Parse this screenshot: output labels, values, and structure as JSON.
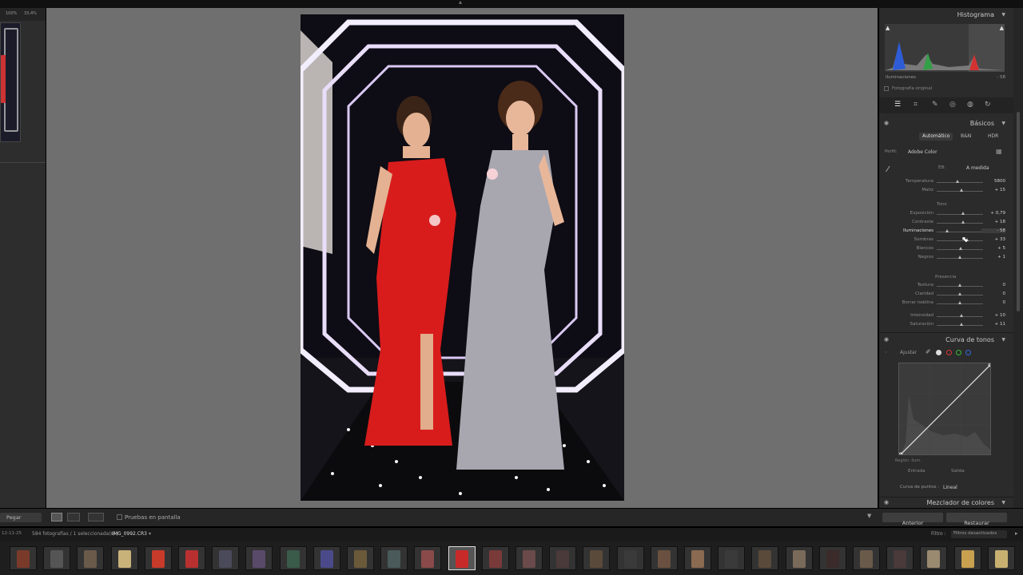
{
  "top": {
    "arrow": "▴"
  },
  "left_panel": {
    "header_a": "100%",
    "header_b": "33,4%"
  },
  "histogram": {
    "title": "Histograma",
    "readout_label": "Iluminaciones",
    "readout_value": "- 58",
    "original_photo": "Fotografía original"
  },
  "basic": {
    "title": "Básicos",
    "treatment": [
      "Automático",
      "B&N",
      "HDR"
    ],
    "profile_label": "Perfil:",
    "profile_value": "Adobe Color",
    "wb_label": "EB:",
    "wb_value": "A medida",
    "sliders_wb": [
      {
        "label": "Temperatura",
        "value": "5800",
        "pos": 0.45
      },
      {
        "label": "Matiz",
        "value": "+ 15",
        "pos": 0.55
      }
    ],
    "tone_heading": "Tono",
    "sliders_tone": [
      {
        "label": "Exposición",
        "value": "+ 0,79",
        "pos": 0.57
      },
      {
        "label": "Contraste",
        "value": "+ 18",
        "pos": 0.57
      },
      {
        "label": "Iluminaciones",
        "value": "- 58",
        "pos": 0.23
      },
      {
        "label": "Sombras",
        "value": "+ 33",
        "pos": 0.67
      },
      {
        "label": "Blancos",
        "value": "+ 5",
        "pos": 0.53
      },
      {
        "label": "Negros",
        "value": "+ 1",
        "pos": 0.51
      }
    ],
    "presence_heading": "Presencia",
    "sliders_presence": [
      {
        "label": "Textura",
        "value": "0",
        "pos": 0.5
      },
      {
        "label": "Claridad",
        "value": "0",
        "pos": 0.5
      },
      {
        "label": "Borrar neblina",
        "value": "0",
        "pos": 0.5
      },
      {
        "label": "Intensidad",
        "value": "+ 10",
        "pos": 0.55
      },
      {
        "label": "Saturación",
        "value": "+ 11",
        "pos": 0.55
      }
    ]
  },
  "curve": {
    "title": "Curva de tonos",
    "adjust_label": "Ajustar",
    "in_label": "Entrada",
    "out_label": "Salida",
    "region": "Región: Ilum.",
    "point_curve_label": "Curva de puntos :",
    "point_curve_value": "Lineal"
  },
  "mixer": {
    "title": "Mezclador de colores"
  },
  "buttons": {
    "prev": "Anterior",
    "reset": "Restaurar",
    "paste": "Pegar"
  },
  "toolbar": {
    "proof_label": "Pruebas en pantalla"
  },
  "filmstrip_bar": {
    "date": "12-11-25",
    "count": "584 fotografías / 1 seleccionada(s) /",
    "filename": "IMG_0992.CR3",
    "filter_label": "Filtro :",
    "filter_value": "Filtros desactivados"
  },
  "colors": {
    "accent": "#c8c8c8",
    "panel": "#2b2b2b",
    "center": "#6f6f6f",
    "dress_red": "#d81c1c"
  }
}
